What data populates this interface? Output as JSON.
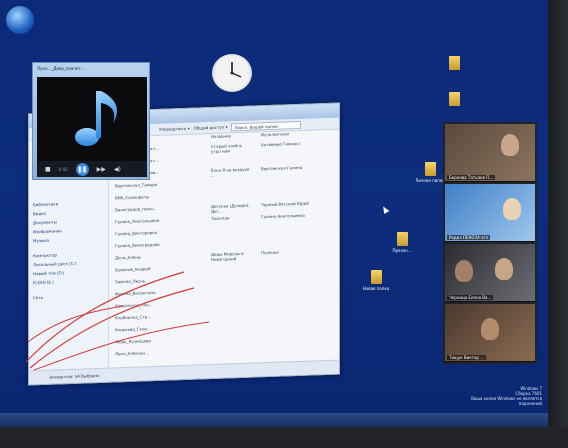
{
  "desktop": {
    "icons": [
      {
        "label": ""
      },
      {
        "label": ""
      },
      {
        "label": "Личная папка"
      },
      {
        "label": "Презен..."
      },
      {
        "label": "Новая папка"
      }
    ]
  },
  "player": {
    "title": "Лунн..._Дева_плачет...",
    "time": "0:02",
    "buttons": {
      "stop": "■",
      "prev": "◀◀",
      "play": "❚❚",
      "next": "▶▶",
      "volume": "◀)"
    }
  },
  "explorer": {
    "address": "Поиск: Вашей папки",
    "toolbar_items": [
      "Упорядочить ▾",
      "Общий доступ ▾"
    ],
    "nav": [
      "Библиотеки",
      "Видео",
      "Документы",
      "Изображения",
      "Музыка",
      "Компьютер",
      "Локальный диск (C:)",
      "Новый том (D:)",
      "FLESH (E:)",
      "Сеть"
    ],
    "column_headers": [
      "Имя",
      "Название",
      "Исполнители"
    ],
    "files": [
      {
        "name": "Активные_Гимнаст...",
        "title": "Старый хлеб в утро нам",
        "artist": "Активные Гимнаст"
      },
      {
        "name": "Активные_Гимнаст...",
        "title": "",
        "artist": ""
      },
      {
        "name": "Вертинская_Любов...",
        "title": "Ёлка Я на воздухе ...",
        "artist": "Вертинская Галина"
      },
      {
        "name": "Вертинская_Тамара",
        "title": "",
        "artist": ""
      },
      {
        "name": "ВИА_Самоцветы",
        "title": "",
        "artist": ""
      },
      {
        "name": "Виноградов_Нани...",
        "title": "Детская (Дочери), Дет...",
        "artist": "Черный Вятский Юрий"
      },
      {
        "name": "Галина_Анатольевна",
        "title": "Тюльпан",
        "artist": "Галина Анатольевна"
      },
      {
        "name": "Галина_Викторовна",
        "title": "",
        "artist": ""
      },
      {
        "name": "Галина_Виноградова",
        "title": "",
        "artist": ""
      },
      {
        "name": "Дети_Алены",
        "title": "Деды Морозы в Новогодний",
        "artist": "Полянок"
      },
      {
        "name": "Ермаков_Андрей",
        "title": "",
        "artist": ""
      },
      {
        "name": "Зимняя_Песнь",
        "title": "",
        "artist": ""
      },
      {
        "name": "Инкина_Валентина",
        "title": "",
        "artist": ""
      },
      {
        "name": "Кавказская_пле...",
        "title": "",
        "artist": ""
      },
      {
        "name": "Клубничка_Стр...",
        "title": "",
        "artist": ""
      },
      {
        "name": "Конькова_Гали...",
        "title": "",
        "artist": ""
      },
      {
        "name": "Люда_Кузнецова",
        "title": "",
        "artist": ""
      },
      {
        "name": "Лунн_Алексан...",
        "title": "",
        "artist": ""
      }
    ],
    "status": "Элементов: 54 Выбрано"
  },
  "video_call": {
    "participants": [
      {
        "name": "Бернова Татьяна П..."
      },
      {
        "name": "Родил ПЕКОЗА агл"
      },
      {
        "name": "Черница Елена Ва..."
      },
      {
        "name": "Тищук Виктор ..."
      }
    ]
  },
  "tray": {
    "line1": "Windows 7",
    "line2": "Сборка 7601",
    "line3": "Ваша копия Windows не является подлинной"
  },
  "colors": {
    "desktop_bg": "#0b2a78",
    "pen_ink": "#d43a3a",
    "player_accent": "#1d64c4"
  }
}
